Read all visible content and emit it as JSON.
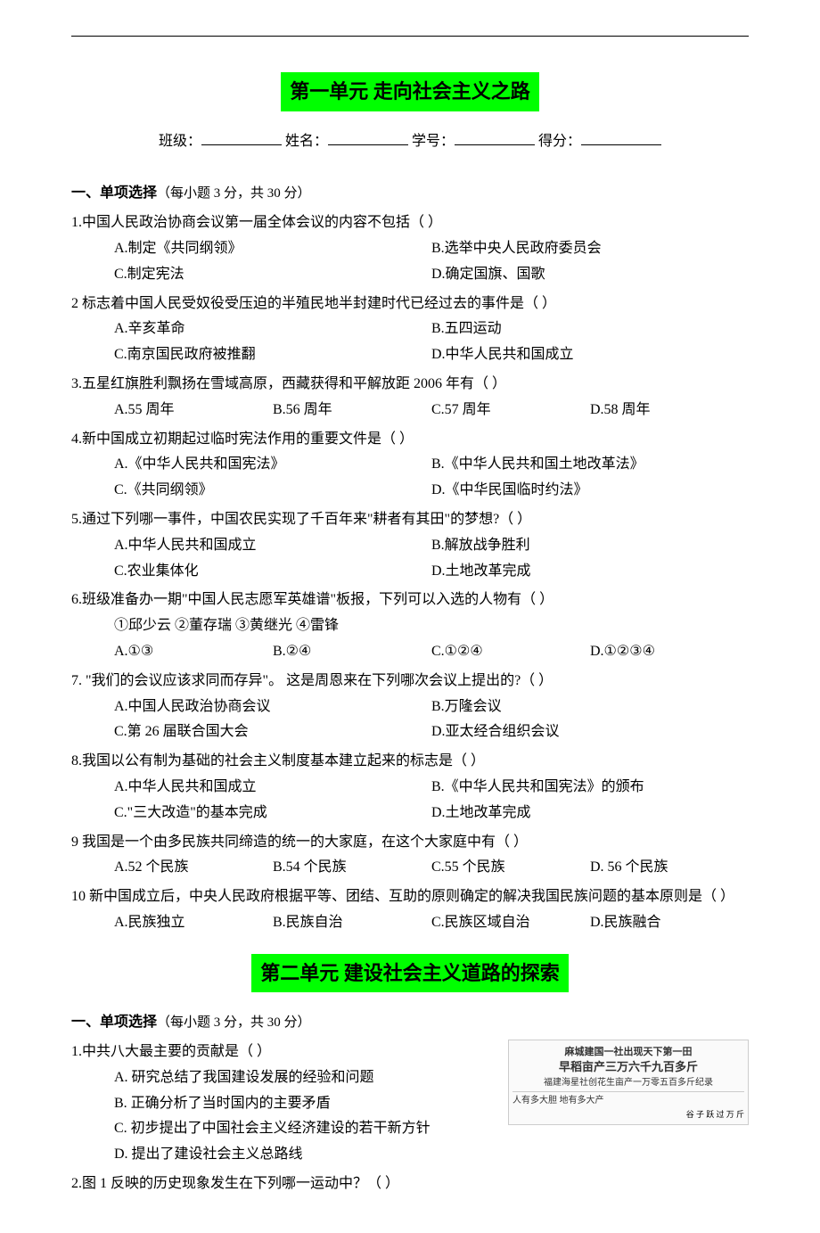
{
  "unit1": {
    "title": "第一单元    走向社会主义之路",
    "info": {
      "class": "班级：",
      "name": "姓名：",
      "id": "学号：",
      "score": "得分："
    },
    "sectionA": "一、单项选择",
    "sectionA_note": "（每小题 3 分，共 30 分）",
    "questions": [
      {
        "stem": "1.中国人民政治协商会议第一届全体会议的内容不包括（    ）",
        "opts": [
          "A.制定《共同纲领》",
          "B.选举中央人民政府委员会",
          "C.制定宪法",
          "D.确定国旗、国歌"
        ],
        "layout": "2col"
      },
      {
        "stem": "2 标志着中国人民受奴役受压迫的半殖民地半封建时代已经过去的事件是（    ）",
        "opts": [
          "A.辛亥革命",
          "B.五四运动",
          "C.南京国民政府被推翻",
          "D.中华人民共和国成立"
        ],
        "layout": "2col"
      },
      {
        "stem": "3.五星红旗胜利飘扬在雪域高原，西藏获得和平解放距 2006 年有（    ）",
        "opts": [
          "A.55 周年",
          "B.56 周年",
          "C.57 周年",
          "D.58 周年"
        ],
        "layout": "4col"
      },
      {
        "stem": "4.新中国成立初期起过临时宪法作用的重要文件是（    ）",
        "opts": [
          "A.《中华人民共和国宪法》",
          "B.《中华人民共和国土地改革法》",
          "C.《共同纲领》",
          "D.《中华民国临时约法》"
        ],
        "layout": "2col"
      },
      {
        "stem": "5.通过下列哪一事件，中国农民实现了千百年来\"耕者有其田\"的梦想?（    ）",
        "opts": [
          "A.中华人民共和国成立",
          "B.解放战争胜利",
          "C.农业集体化",
          "D.土地改革完成"
        ],
        "layout": "2col"
      },
      {
        "stem": "6.班级准备办一期\"中国人民志愿军英雄谱\"板报，下列可以入选的人物有（    ）",
        "sub": "①邱少云    ②董存瑞    ③黄继光    ④雷锋",
        "opts": [
          "A.①③",
          "B.②④",
          "C.①②④",
          "D.①②③④"
        ],
        "layout": "4col"
      },
      {
        "stem": "7. \"我们的会议应该求同而存异\"。 这是周恩来在下列哪次会议上提出的?（    ）",
        "opts": [
          "A.中国人民政治协商会议",
          "B.万隆会议",
          "C.第 26 届联合国大会",
          "D.亚太经合组织会议"
        ],
        "layout": "2col"
      },
      {
        "stem": "8.我国以公有制为基础的社会主义制度基本建立起来的标志是（    ）",
        "opts": [
          "A.中华人民共和国成立",
          "B.《中华人民共和国宪法》的颁布",
          "C.\"三大改造\"的基本完成",
          "D.土地改革完成"
        ],
        "layout": "2col"
      },
      {
        "stem": "9 我国是一个由多民族共同缔造的统一的大家庭，在这个大家庭中有（    ）",
        "opts": [
          "A.52 个民族",
          "B.54 个民族",
          "C.55 个民族",
          "D. 56 个民族"
        ],
        "layout": "4col"
      },
      {
        "stem": "10 新中国成立后，中央人民政府根据平等、团结、互助的原则确定的解决我国民族问题的基本原则是（    ）",
        "opts": [
          "A.民族独立",
          "B.民族自治",
          "C.民族区域自治",
          "D.民族融合"
        ],
        "layout": "4col"
      }
    ]
  },
  "unit2": {
    "title": "第二单元    建设社会主义道路的探索",
    "sectionA": "一、单项选择",
    "sectionA_note": "（每小题 3 分，共 30 分）",
    "questions": [
      {
        "stem": "1.中共八大最主要的贡献是（    ）",
        "opts": [
          "A. 研究总结了我国建设发展的经验和问题",
          "B. 正确分析了当时国内的主要矛盾",
          "C. 初步提出了中国社会主义经济建设的若干新方针",
          "D. 提出了建设社会主义总路线"
        ],
        "layout": "1col"
      },
      {
        "stem": "2.图 1 反映的历史现象发生在下列哪一运动中？（    ）"
      }
    ],
    "figure": {
      "line1": "麻城建国一社出现天下第一田",
      "line2": "早稻亩产三万六千九百多斤",
      "line3": "福建海星社创花生亩产一万零五百多斤纪录",
      "line4": "人有多大胆  地有多大产",
      "line5": "谷 子 跃 过 万 斤"
    }
  }
}
